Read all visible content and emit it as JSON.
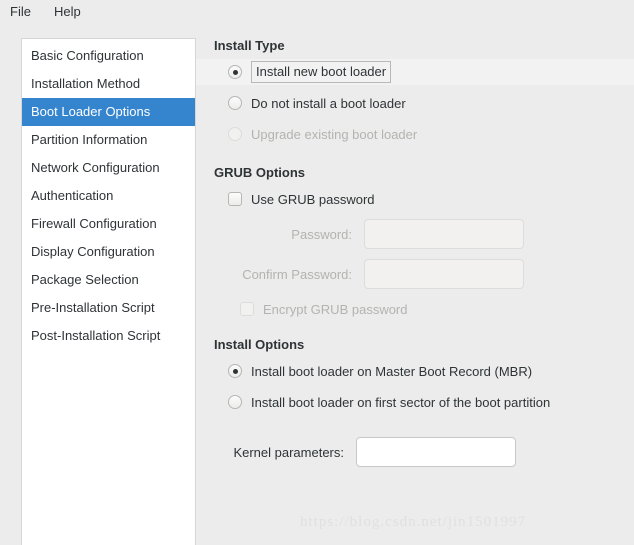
{
  "menubar": {
    "items": [
      {
        "label": "File"
      },
      {
        "label": "Help"
      }
    ]
  },
  "sidebar": {
    "items": [
      {
        "label": "Basic Configuration",
        "selected": false
      },
      {
        "label": "Installation Method",
        "selected": false
      },
      {
        "label": "Boot Loader Options",
        "selected": true
      },
      {
        "label": "Partition Information",
        "selected": false
      },
      {
        "label": "Network Configuration",
        "selected": false
      },
      {
        "label": "Authentication",
        "selected": false
      },
      {
        "label": "Firewall Configuration",
        "selected": false
      },
      {
        "label": "Display Configuration",
        "selected": false
      },
      {
        "label": "Package Selection",
        "selected": false
      },
      {
        "label": "Pre-Installation Script",
        "selected": false
      },
      {
        "label": "Post-Installation Script",
        "selected": false
      }
    ]
  },
  "install_type": {
    "title": "Install Type",
    "options": [
      {
        "label": "Install new boot loader",
        "selected": true,
        "disabled": false,
        "focused": true
      },
      {
        "label": "Do not install a boot loader",
        "selected": false,
        "disabled": false,
        "focused": false
      },
      {
        "label": "Upgrade existing boot loader",
        "selected": false,
        "disabled": true,
        "focused": false
      }
    ]
  },
  "grub_options": {
    "title": "GRUB Options",
    "use_password": {
      "label": "Use GRUB password",
      "checked": false,
      "disabled": false
    },
    "password": {
      "label": "Password:",
      "value": "",
      "placeholder": "",
      "disabled": true
    },
    "confirm_password": {
      "label": "Confirm Password:",
      "value": "",
      "placeholder": "",
      "disabled": true
    },
    "encrypt": {
      "label": "Encrypt GRUB password",
      "checked": false,
      "disabled": true
    }
  },
  "install_options": {
    "title": "Install Options",
    "options": [
      {
        "label": "Install boot loader on Master Boot Record (MBR)",
        "selected": true,
        "disabled": false
      },
      {
        "label": "Install boot loader on first sector of the boot partition",
        "selected": false,
        "disabled": false
      }
    ],
    "kernel_parameters": {
      "label": "Kernel parameters:",
      "value": "",
      "placeholder": "",
      "disabled": false
    }
  },
  "watermark": {
    "text": "https://blog.csdn.net/jin1501997"
  },
  "colors": {
    "selection_blue": "#3584ce",
    "window_bg": "#ececec",
    "panel_bg": "#ffffff",
    "disabled_text": "#b3b3b0",
    "text": "#2e3436"
  }
}
